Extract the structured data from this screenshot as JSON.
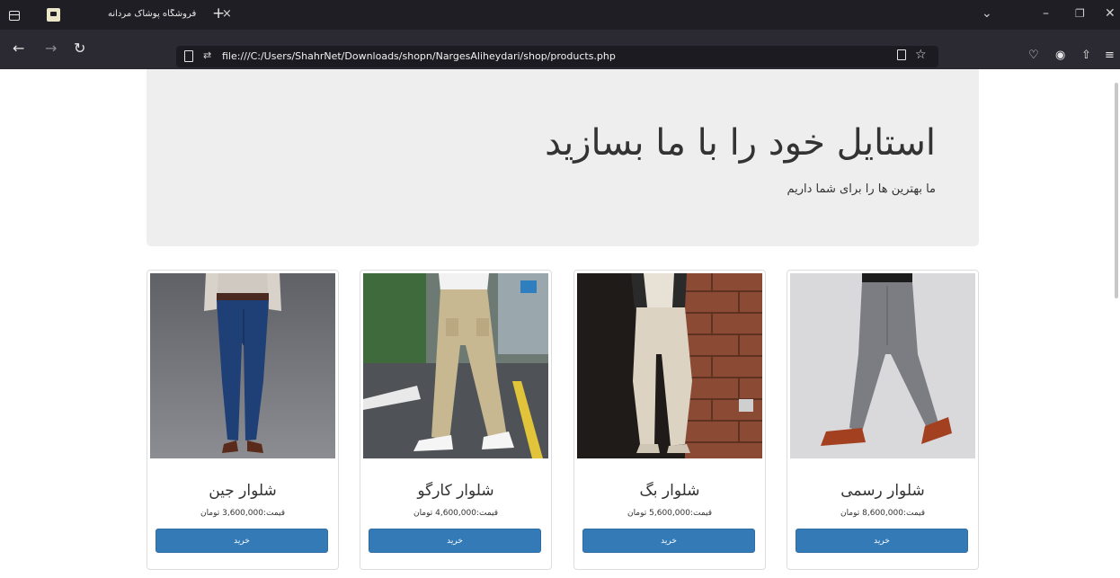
{
  "browser": {
    "tab_title": "فروشگاه پوشاک مردانه",
    "tab_close": "×",
    "new_tab": "+",
    "url": "file:///C:/Users/ShahrNet/Downloads/shopn/NargesAliheydari/shop/products.php",
    "controls": {
      "minimize": "–",
      "restore": "❐",
      "close": "✕",
      "list_tabs": "⌄"
    }
  },
  "hero": {
    "title": "استایل خود را با ما بسازید",
    "subtitle": "ما بهترین ها را برای شما داریم",
    "background": "#eeeeee"
  },
  "products": [
    {
      "name": "شلوار جین",
      "price": "قیمت:3,600,000 تومان",
      "buy": "خرید"
    },
    {
      "name": "شلوار کارگو",
      "price": "قیمت:4,600,000 تومان",
      "buy": "خرید"
    },
    {
      "name": "شلوار بگ",
      "price": "قیمت:5,600,000 تومان",
      "buy": "خرید"
    },
    {
      "name": "شلوار رسمی",
      "price": "قیمت:8,600,000 تومان",
      "buy": "خرید"
    }
  ],
  "colors": {
    "button": "#337ab7",
    "chrome_dark": "#1f1e25",
    "toolbar": "#2b2a33"
  },
  "icons": [
    "sidebar-icon",
    "favicon-icon",
    "back-arrow-icon",
    "forward-arrow-icon",
    "reload-icon",
    "page-icon",
    "permissions-icon",
    "reader-view-icon",
    "bookmark-star-icon",
    "pocket-icon",
    "account-icon",
    "extensions-icon",
    "menu-icon"
  ]
}
